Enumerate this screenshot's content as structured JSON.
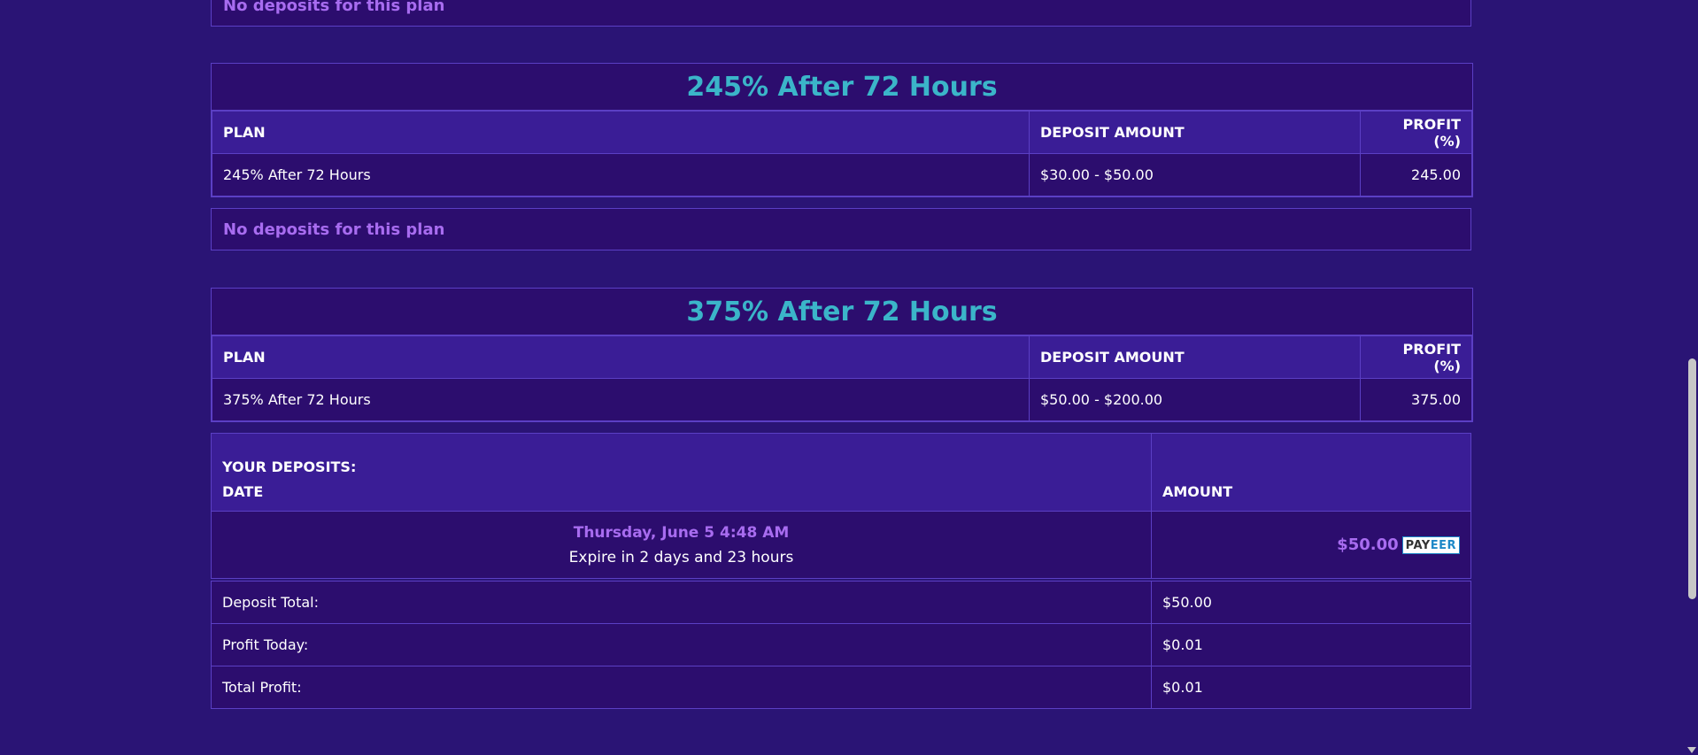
{
  "top_notice": "No deposits for this plan",
  "plans": [
    {
      "title": "245% After 72 Hours",
      "headers": {
        "plan": "PLAN",
        "deposit": "DEPOSIT AMOUNT",
        "profit": "PROFIT (%)"
      },
      "row": {
        "plan": "245% After 72 Hours",
        "deposit": "$30.00 - $50.00",
        "profit": "245.00"
      },
      "notice": "No deposits for this plan"
    },
    {
      "title": "375% After 72 Hours",
      "headers": {
        "plan": "PLAN",
        "deposit": "DEPOSIT AMOUNT",
        "profit": "PROFIT (%)"
      },
      "row": {
        "plan": "375% After 72 Hours",
        "deposit": "$50.00 - $200.00",
        "profit": "375.00"
      }
    }
  ],
  "deposits": {
    "heading": "YOUR DEPOSITS:",
    "date_header": "DATE",
    "amount_header": "AMOUNT",
    "row": {
      "date": "Thursday, June 5 4:48 AM",
      "expire": "Expire in 2 days and 23 hours",
      "amount": "$50.00",
      "method_icon": "payeer-logo",
      "method_logo_text": "PAYEER"
    }
  },
  "totals": [
    {
      "label": "Deposit Total:",
      "value": "$50.00"
    },
    {
      "label": "Profit Today:",
      "value": "$0.01"
    },
    {
      "label": "Total Profit:",
      "value": "$0.01"
    }
  ],
  "colors": {
    "background": "#2a1475",
    "panel": "#2c0d6e",
    "header": "#3a1d96",
    "title_accent": "#3bb5c9",
    "purple_text": "#a86cf0"
  }
}
